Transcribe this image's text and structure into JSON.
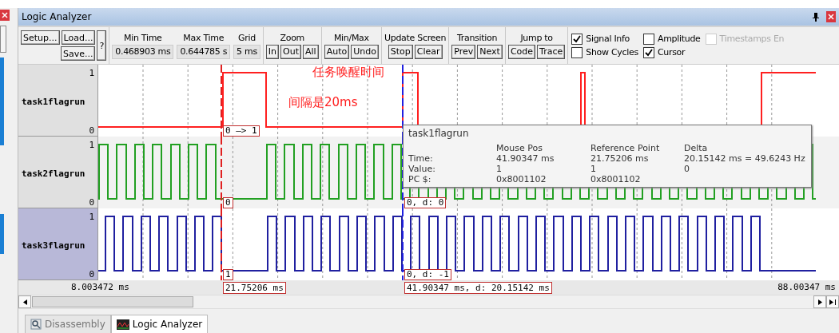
{
  "window": {
    "title": "Logic Analyzer"
  },
  "toolbar": {
    "file_buttons": [
      "Setup...",
      "Load...",
      "Save..."
    ],
    "help": "?",
    "readouts": [
      {
        "label": "Min Time",
        "value": "0.468903 ms"
      },
      {
        "label": "Max Time",
        "value": "0.644785 s"
      },
      {
        "label": "Grid",
        "value": "5 ms"
      }
    ],
    "groups": [
      {
        "title": "Zoom",
        "buttons": [
          "In",
          "Out",
          "All"
        ]
      },
      {
        "title": "Min/Max",
        "buttons": [
          "Auto",
          "Undo"
        ]
      },
      {
        "title": "Update Screen",
        "buttons": [
          "Stop",
          "Clear"
        ]
      },
      {
        "title": "Transition",
        "buttons": [
          "Prev",
          "Next"
        ]
      },
      {
        "title": "Jump to",
        "buttons": [
          "Code",
          "Trace"
        ]
      }
    ],
    "checkboxes": [
      {
        "label": "Signal Info",
        "checked": true,
        "disabled": false
      },
      {
        "label": "Show Cycles",
        "checked": false,
        "disabled": false
      },
      {
        "label": "Amplitude",
        "checked": false,
        "disabled": false
      },
      {
        "label": "Cursor",
        "checked": true,
        "disabled": false
      },
      {
        "label": "Timestamps En",
        "checked": false,
        "disabled": true
      }
    ]
  },
  "signals": [
    {
      "name": "task1flagrun",
      "high": "1",
      "low": "0",
      "color": "#ff2020",
      "selected": false,
      "ref_label": "0 —> 1"
    },
    {
      "name": "task2flagrun",
      "high": "1",
      "low": "0",
      "color": "#22a022",
      "selected": false,
      "ref_label": "0",
      "mouse_label": "0,  d: 0"
    },
    {
      "name": "task3flagrun",
      "high": "1",
      "low": "0",
      "color": "#2020a0",
      "selected": true,
      "ref_label": "1",
      "mouse_label": "0,  d: -1"
    }
  ],
  "annotations": [
    "任务唤醒时间",
    "间隔是20ms"
  ],
  "tooltip": {
    "title": "task1flagrun",
    "columns": [
      "Mouse Pos",
      "Reference Point",
      "Delta"
    ],
    "rows": [
      {
        "label": "Time:",
        "values": [
          "41.90347 ms",
          "21.75206 ms",
          "20.15142 ms = 49.6243 Hz"
        ]
      },
      {
        "label": "Value:",
        "values": [
          "1",
          "1",
          "0"
        ]
      },
      {
        "label": "PC $:",
        "values": [
          "0x8001102",
          "0x8001102"
        ]
      }
    ]
  },
  "time_axis": {
    "start": "8.003472 ms",
    "reference": "21.75206 ms",
    "mouse": "41.90347 ms,  d: 20.15142 ms",
    "end": "88.00347 ms"
  },
  "tabs": [
    {
      "label": "Disassembly",
      "selected": false
    },
    {
      "label": "Logic Analyzer",
      "selected": true
    }
  ]
}
